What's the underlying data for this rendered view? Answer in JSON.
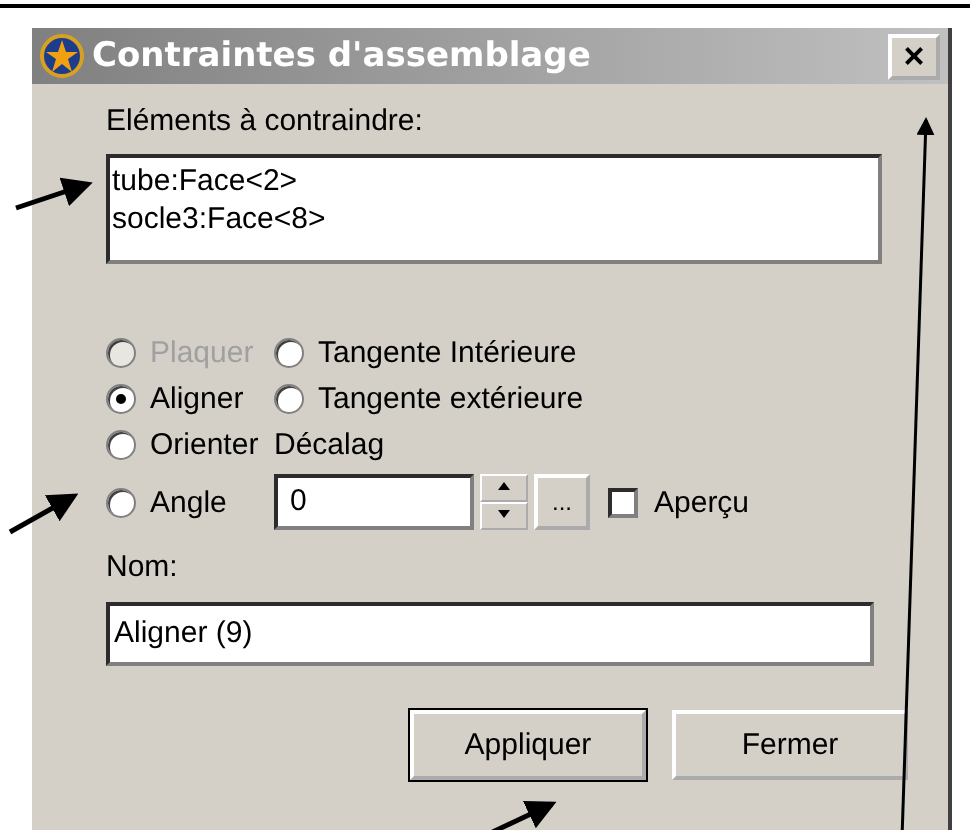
{
  "window": {
    "title": "Contraintes d'assemblage",
    "close": "×"
  },
  "elements": {
    "label": "Eléments à contraindre:",
    "items": [
      "tube:Face<2>",
      "socle3:Face<8>"
    ]
  },
  "options": [
    {
      "label": "Plaquer",
      "selected": false,
      "disabled": true
    },
    {
      "label": "Tangente Intérieure",
      "selected": false,
      "disabled": false
    },
    {
      "label": "Aligner",
      "selected": true,
      "disabled": false
    },
    {
      "label": "Tangente extérieure",
      "selected": false,
      "disabled": false
    },
    {
      "label": "Orienter",
      "selected": false,
      "disabled": false
    },
    {
      "label": "Angle",
      "selected": false,
      "disabled": false
    }
  ],
  "offset": {
    "label": "Décalag",
    "value": "0",
    "more": "...",
    "preview": {
      "label": "Aperçu",
      "checked": false
    }
  },
  "name": {
    "label": "Nom:",
    "value": "Aligner (9)"
  },
  "buttons": [
    {
      "label": "Appliquer",
      "default": true
    },
    {
      "label": "Fermer",
      "default": false
    }
  ]
}
